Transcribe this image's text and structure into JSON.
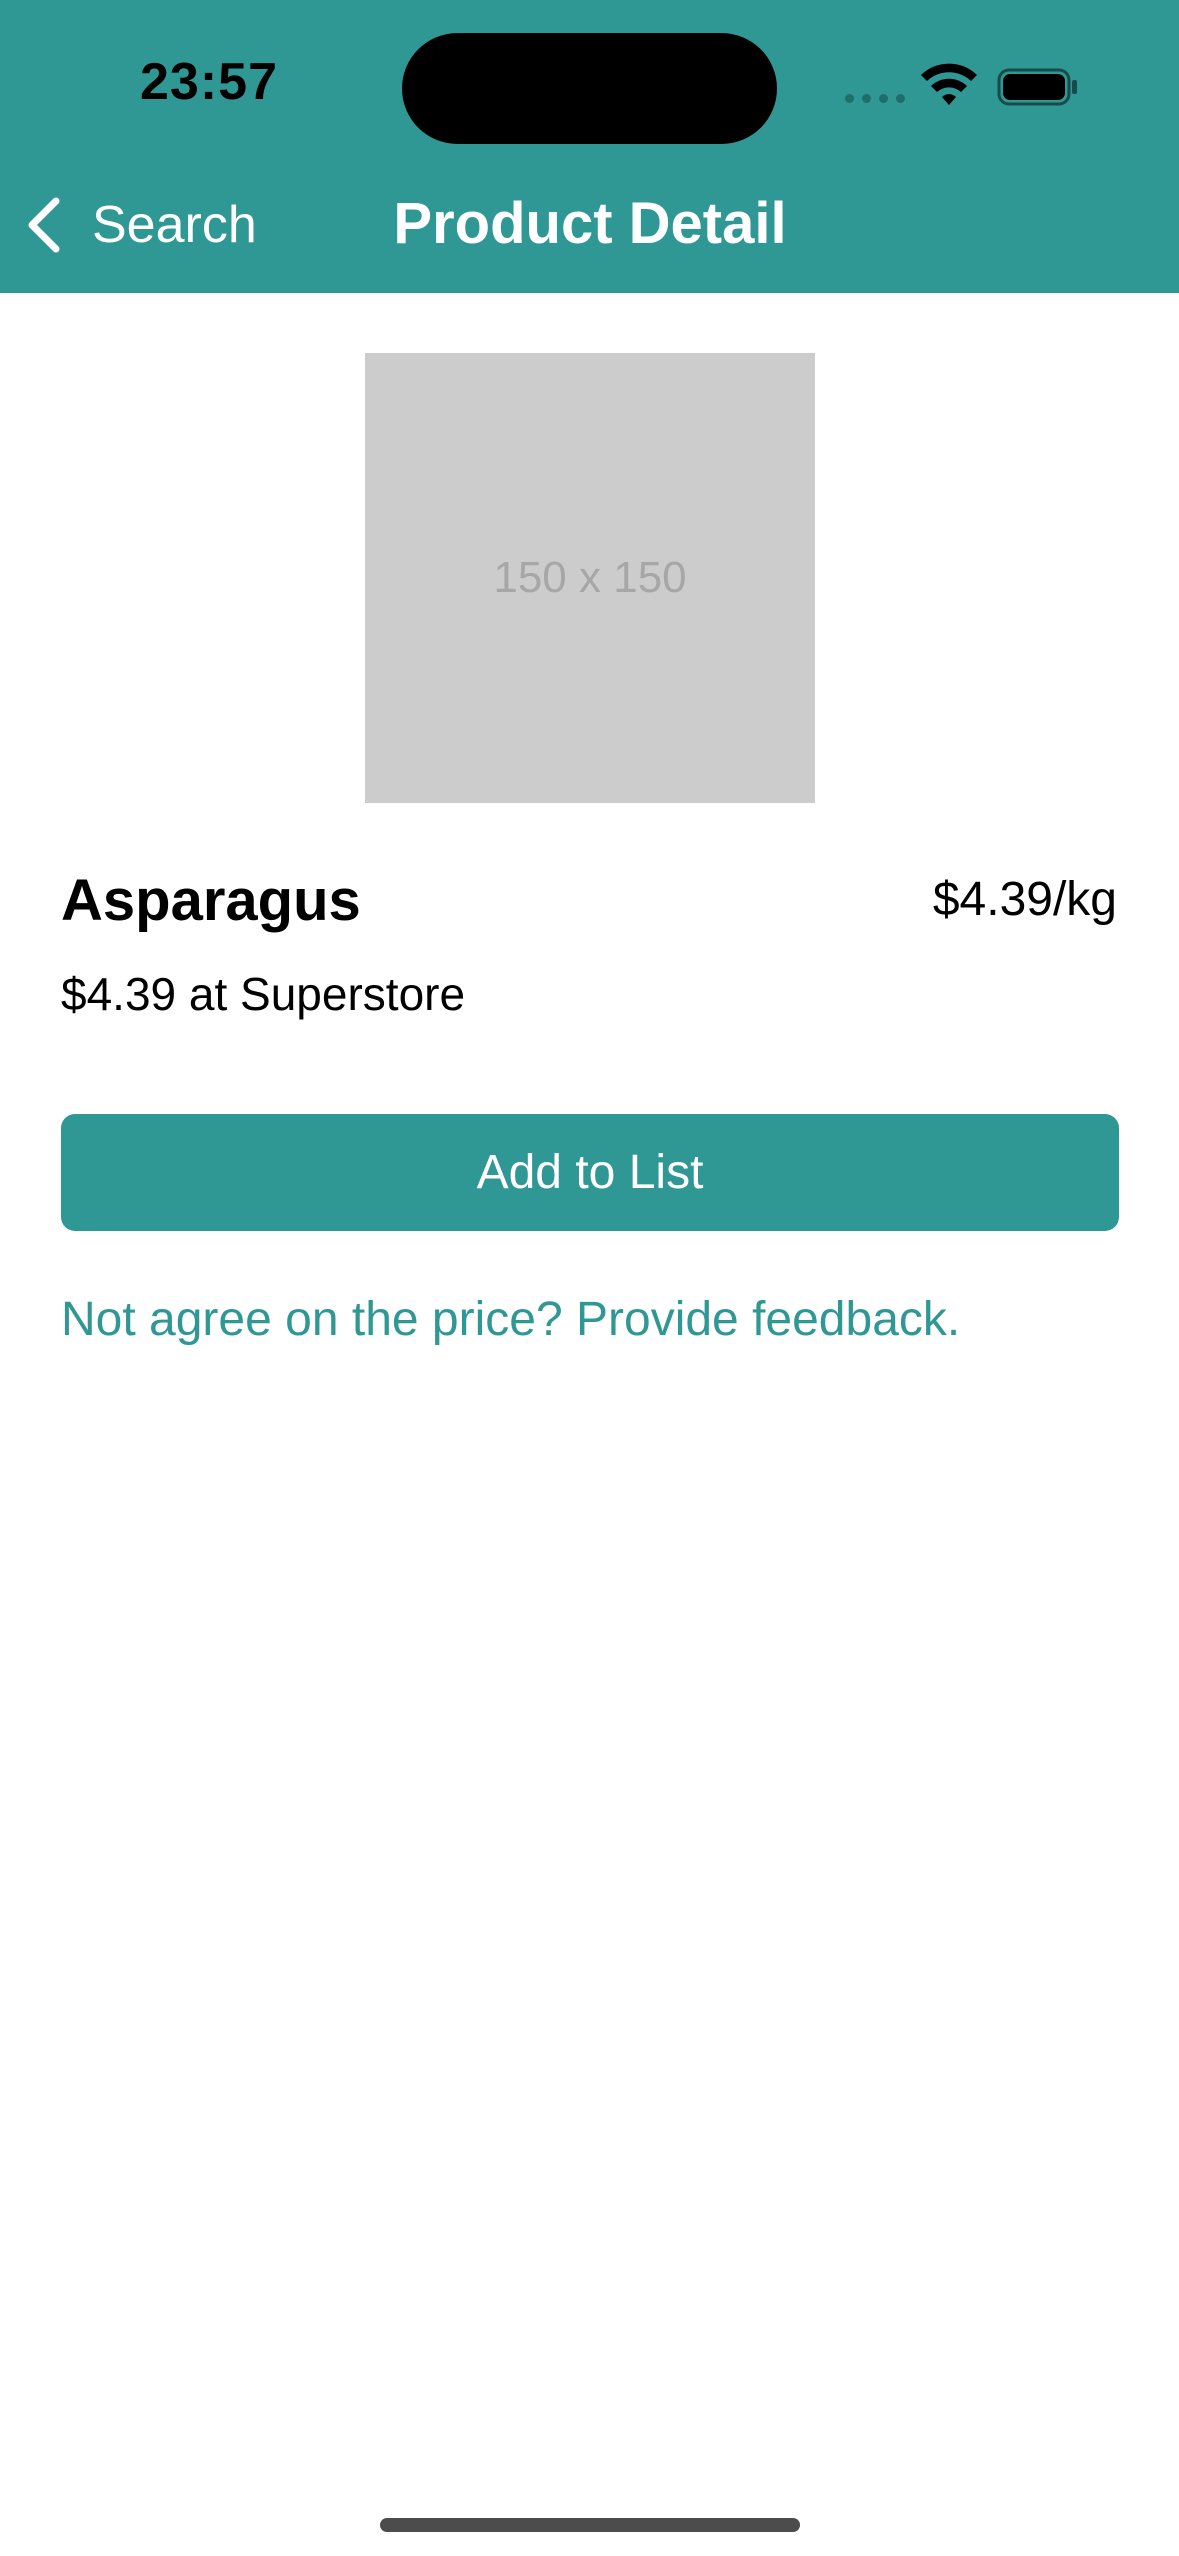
{
  "status_bar": {
    "time": "23:57"
  },
  "nav": {
    "back_label": "Search",
    "title": "Product Detail"
  },
  "product": {
    "image_placeholder": "150 x 150",
    "name": "Asparagus",
    "unit_price": "$4.39/kg",
    "store_price": "$4.39 at Superstore"
  },
  "actions": {
    "add_to_list_label": "Add to List",
    "feedback_link": "Not agree on the price? Provide feedback."
  },
  "colors": {
    "accent": "#309894",
    "placeholder_bg": "#cccccc",
    "placeholder_text": "#a7a7a7"
  },
  "icons": {
    "back": "chevron-left-icon",
    "signal": "signal-dots-icon",
    "wifi": "wifi-icon",
    "battery": "battery-icon"
  }
}
